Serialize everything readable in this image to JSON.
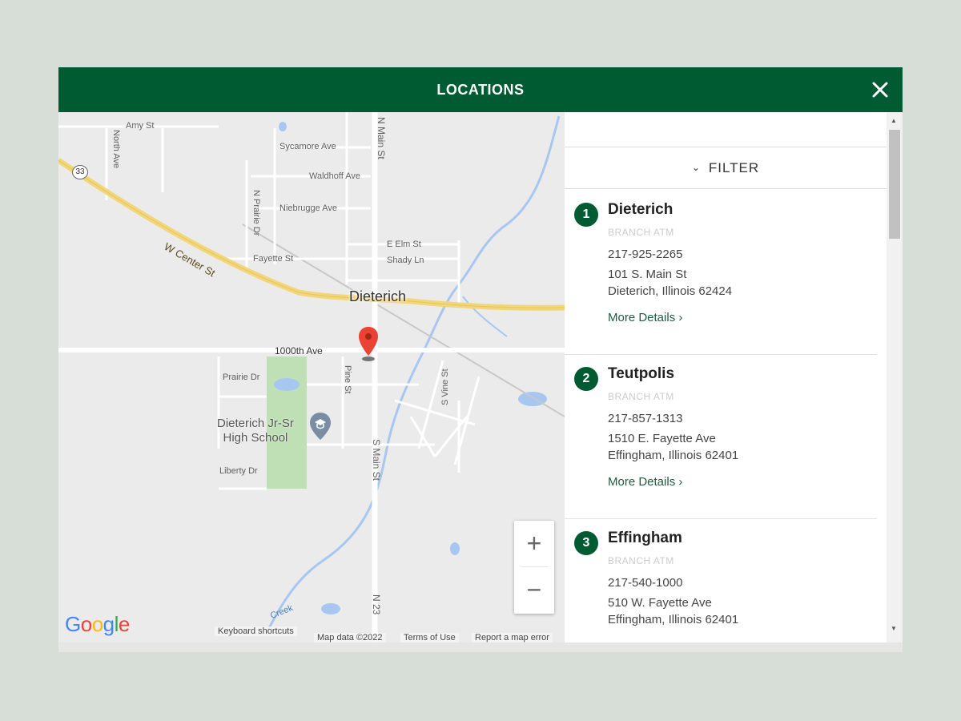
{
  "modal": {
    "title": "LOCATIONS",
    "close_icon": "close-icon"
  },
  "colors": {
    "brand_green": "#005b32",
    "background": "#d6ded7"
  },
  "map": {
    "town": "Dieterich",
    "school_line1": "Dieterich Jr-Sr",
    "school_line2": "High School",
    "highway_number": "33",
    "streets": {
      "amy": "Amy St",
      "sycamore": "Sycamore Ave",
      "waldhoff": "Waldhoff Ave",
      "niebrugge": "Niebrugge Ave",
      "fayette": "Fayette St",
      "elm": "E Elm St",
      "shady": "Shady Ln",
      "w_center": "W Center St",
      "ave_1000th": "1000th Ave",
      "prairie": "Prairie Dr",
      "pine": "Pine St",
      "liberty": "Liberty Dr",
      "north_ave": "North Ave",
      "n_prairie": "N Prairie Dr",
      "n_main": "N Main St",
      "s_main": "S Main St",
      "s_vine": "S Vine St",
      "n_23": "N 23",
      "creek": "Creek"
    },
    "zoom_in": "+",
    "zoom_out": "−",
    "google": [
      "G",
      "o",
      "o",
      "g",
      "l",
      "e"
    ],
    "footer": {
      "shortcuts": "Keyboard shortcuts",
      "map_data": "Map data ©2022",
      "terms": "Terms of Use",
      "report": "Report a map error"
    }
  },
  "panel": {
    "filter_label": "FILTER",
    "locations": [
      {
        "number": "1",
        "name": "Dieterich",
        "type": "BRANCH  ATM",
        "phone": "217-925-2265",
        "address1": "101 S. Main St",
        "address2": "Dieterich, Illinois 62424",
        "more": "More Details ›"
      },
      {
        "number": "2",
        "name": "Teutpolis",
        "type": "BRANCH  ATM",
        "phone": "217-857-1313",
        "address1": "1510 E. Fayette Ave",
        "address2": "Effingham, Illinois 62401",
        "more": "More Details ›"
      },
      {
        "number": "3",
        "name": "Effingham",
        "type": "BRANCH  ATM",
        "phone": "217-540-1000",
        "address1": "510 W. Fayette Ave",
        "address2": "Effingham, Illinois 62401",
        "more": "More Details ›"
      }
    ]
  }
}
